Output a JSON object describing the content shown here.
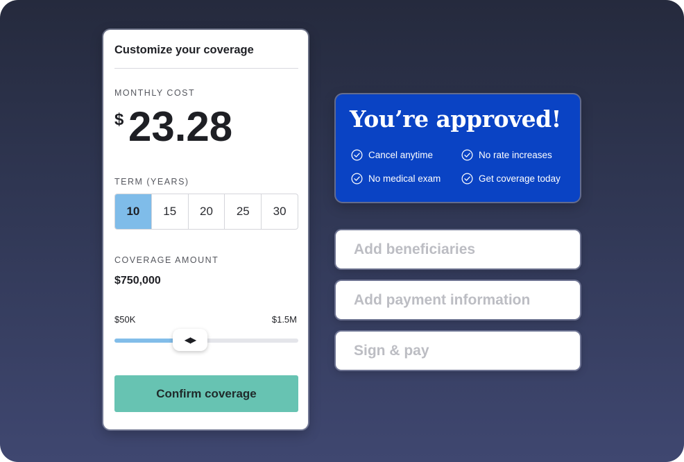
{
  "coverage_card": {
    "title": "Customize your coverage",
    "monthly_cost_label": "MONTHLY COST",
    "currency_symbol": "$",
    "monthly_cost": "23.28",
    "term_label": "TERM (YEARS)",
    "terms": [
      "10",
      "15",
      "20",
      "25",
      "30"
    ],
    "selected_term": "10",
    "coverage_label": "COVERAGE AMOUNT",
    "coverage_amount": "$750,000",
    "slider": {
      "min_label": "$50K",
      "max_label": "$1.5M",
      "fill_fraction": 0.41,
      "thumb_glyph": "◀▶"
    },
    "confirm_label": "Confirm coverage"
  },
  "approval": {
    "title": "You’re approved!",
    "features": [
      "Cancel anytime",
      "No rate increases",
      "No medical exam",
      "Get coverage today"
    ]
  },
  "steps": [
    "Add beneficiaries",
    "Add payment information",
    "Sign & pay"
  ],
  "colors": {
    "accent_blue": "#0a43c4",
    "selected_term": "#7fbce9",
    "confirm_button": "#67c3b2",
    "slider_fill": "#82bde9"
  }
}
